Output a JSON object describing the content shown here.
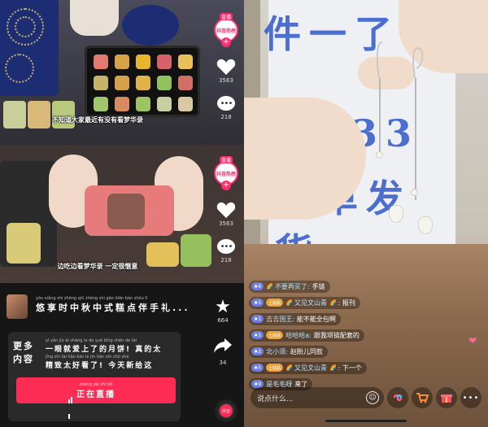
{
  "left_app": {
    "video_top": {
      "subtitle": "不知道大家最近有没有看梦华录",
      "live_badge": "直播",
      "live_logo": "抖音热榜",
      "like_count": "3563",
      "comment_count": "218"
    },
    "video_bottom": {
      "subtitle": "边吃边看梦华录 一定很惬意",
      "live_badge": "直播",
      "live_logo": "抖音热榜",
      "like_count": "3563",
      "comment_count": "218"
    },
    "product": {
      "title_pinyin": "yōu xiǎng shí zhōng qiū zhōng shì gāo diǎn bàn shǒu lǐ",
      "title": "悠享时中秋中式糕点伴手礼..."
    },
    "more": {
      "label": "更多内容",
      "line1_pinyin": "yī yǎn jiù ài shàng le de yuè bǐng zhēn de tài",
      "line1": "一眼就爱上了的月饼! 真的太",
      "line2_pinyin": "jīng zhì tài hǎo kàn le jīn tiān xīn chū zhè",
      "line2": "精致太好看了! 今天新给这"
    },
    "live_button": {
      "pinyin": "zhèng zài zhí bō",
      "label": "正在直播"
    },
    "side": {
      "star_count": "664",
      "share_count": "34",
      "disc_label": "抖音"
    }
  },
  "right_app": {
    "board_lines": [
      "件一了",
      "上场33号",
      "三单发货"
    ],
    "comments": [
      {
        "level": "6",
        "fan": "",
        "name": "不要再买了:",
        "text": "手链",
        "rainbow": true
      },
      {
        "level": "5",
        "fan": "土姑姑",
        "name": "又见文山青",
        "text": "报刊",
        "rainbow": true
      },
      {
        "level": "1",
        "fan": "",
        "name": "吉吉国王:",
        "text": "能不能全包啊",
        "rainbow": false
      },
      {
        "level": "5",
        "fan": "土姑姑",
        "name": "哈哈哈a:",
        "text": "跟我项链配套的",
        "rainbow": false
      },
      {
        "level": "2",
        "fan": "",
        "name": "北小须:",
        "text": "赵盼儿同款",
        "rainbow": false
      },
      {
        "level": "5",
        "fan": "土姑姑",
        "name": "又见文山青",
        "text": "下一个",
        "rainbow": true
      },
      {
        "level": "9",
        "fan": "",
        "name": "是毛毛呀",
        "text": "来了",
        "rainbow": false
      }
    ],
    "input_placeholder": "说点什么...",
    "icons": [
      "emoji-icon",
      "link-icon",
      "cart-icon",
      "gift-icon",
      "more-icon"
    ]
  }
}
